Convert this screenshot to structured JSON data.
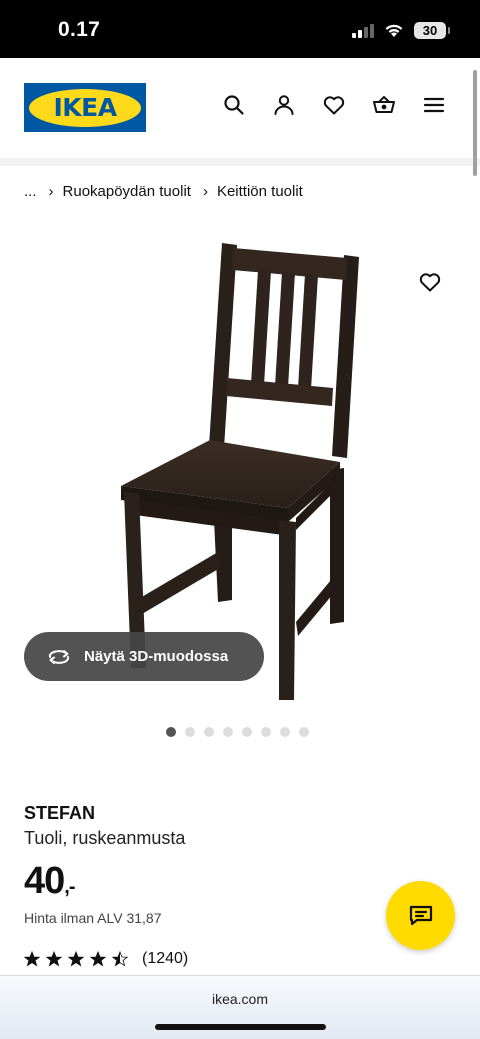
{
  "status_bar": {
    "time": "0.17",
    "battery": "30"
  },
  "header": {
    "logo_text": "IKEA"
  },
  "breadcrumb": {
    "ellipsis": "...",
    "items": [
      "Ruokapöydän tuolit",
      "Keittiön tuolit"
    ]
  },
  "product": {
    "view_3d_label": "Näytä 3D-muodossa",
    "image_count": 8,
    "active_image": 1,
    "name": "STEFAN",
    "description": "Tuoli, ruskeanmusta",
    "price": "40",
    "price_suffix": ",-",
    "vat_text": "Hinta ilman ALV 31,87",
    "rating": 4.5,
    "rating_max": 5,
    "review_count": "(1240)"
  },
  "browser": {
    "url": "ikea.com"
  },
  "colors": {
    "brand_blue": "#0058a3",
    "brand_yellow": "#ffda1a",
    "chair": "#2b211c"
  }
}
